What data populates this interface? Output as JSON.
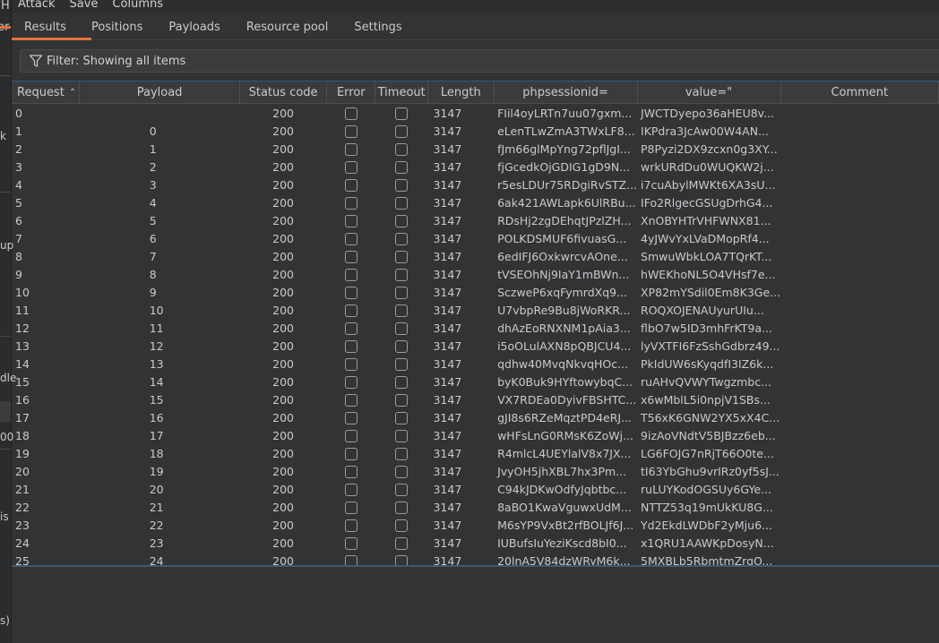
{
  "background_fragments": {
    "menu_letter": "H",
    "tab_fragment": "er",
    "texts": [
      "k",
      "up",
      "dle",
      "00",
      "is",
      "s)"
    ]
  },
  "menu": {
    "items": [
      "Attack",
      "Save",
      "Columns"
    ]
  },
  "tabs": [
    {
      "label": "Results",
      "active": true
    },
    {
      "label": "Positions",
      "active": false
    },
    {
      "label": "Payloads",
      "active": false
    },
    {
      "label": "Resource pool",
      "active": false
    },
    {
      "label": "Settings",
      "active": false
    }
  ],
  "filter": {
    "icon": "filter-funnel-icon",
    "label": "Filter: Showing all items"
  },
  "table": {
    "sort_icon": "chevron-up-icon",
    "columns": [
      "Request",
      "Payload",
      "Status code",
      "Error",
      "Timeout",
      "Length",
      "phpsessionid=",
      "value=\"",
      "Comment"
    ],
    "rows": [
      {
        "request": "0",
        "payload": "",
        "status": "200",
        "error": false,
        "timeout": false,
        "length": "3147",
        "phpsessionid": "FIil4oyLRTn7uu07gxm...",
        "value": "JWCTDyepo36aHEU8v...",
        "comment": ""
      },
      {
        "request": "1",
        "payload": "0",
        "status": "200",
        "error": false,
        "timeout": false,
        "length": "3147",
        "phpsessionid": "eLenTLwZmA3TWxLF8...",
        "value": "IKPdra3JcAw00W4AN...",
        "comment": ""
      },
      {
        "request": "2",
        "payload": "1",
        "status": "200",
        "error": false,
        "timeout": false,
        "length": "3147",
        "phpsessionid": "fJm66glMpYng72pflJgI...",
        "value": "P8Pyzi2DX9zcxn0g3XY...",
        "comment": ""
      },
      {
        "request": "3",
        "payload": "2",
        "status": "200",
        "error": false,
        "timeout": false,
        "length": "3147",
        "phpsessionid": "fjGcedkOjGDIG1gD9N...",
        "value": "wrkURdDu0WUQKW2j...",
        "comment": ""
      },
      {
        "request": "4",
        "payload": "3",
        "status": "200",
        "error": false,
        "timeout": false,
        "length": "3147",
        "phpsessionid": "r5esLDUr75RDgiRvSTZ...",
        "value": "i7cuAbylMWKt6XA3sU...",
        "comment": ""
      },
      {
        "request": "5",
        "payload": "4",
        "status": "200",
        "error": false,
        "timeout": false,
        "length": "3147",
        "phpsessionid": "6ak421AWLapk6UlRBu...",
        "value": "IFo2RlgecGSUgDrhG4...",
        "comment": ""
      },
      {
        "request": "6",
        "payload": "5",
        "status": "200",
        "error": false,
        "timeout": false,
        "length": "3147",
        "phpsessionid": "RDsHj2zgDEhqtJPzlZH...",
        "value": "XnOBYHTrVHFWNX81...",
        "comment": ""
      },
      {
        "request": "7",
        "payload": "6",
        "status": "200",
        "error": false,
        "timeout": false,
        "length": "3147",
        "phpsessionid": "POLKDSMUF6fivuasG...",
        "value": "4yJWvYxLVaDMopRf4...",
        "comment": ""
      },
      {
        "request": "8",
        "payload": "7",
        "status": "200",
        "error": false,
        "timeout": false,
        "length": "3147",
        "phpsessionid": "6edIFJ6OxkwrcvAOne...",
        "value": "SmwuWbkLOA7TQrKT...",
        "comment": ""
      },
      {
        "request": "9",
        "payload": "8",
        "status": "200",
        "error": false,
        "timeout": false,
        "length": "3147",
        "phpsessionid": "tVSEOhNj9IaY1mBWn...",
        "value": "hWEKhoNL5O4VHsf7e...",
        "comment": ""
      },
      {
        "request": "10",
        "payload": "9",
        "status": "200",
        "error": false,
        "timeout": false,
        "length": "3147",
        "phpsessionid": "SczweP6xqFymrdXq9...",
        "value": "XP82mYSdil0Em8K3Ge...",
        "comment": ""
      },
      {
        "request": "11",
        "payload": "10",
        "status": "200",
        "error": false,
        "timeout": false,
        "length": "3147",
        "phpsessionid": "U7vbpRe9Bu8jWoRKR...",
        "value": "ROQXOJENAUyurUIu...",
        "comment": ""
      },
      {
        "request": "12",
        "payload": "11",
        "status": "200",
        "error": false,
        "timeout": false,
        "length": "3147",
        "phpsessionid": "dhAzEoRNXNM1pAia3...",
        "value": "flbO7w5ID3mhFrKT9a...",
        "comment": ""
      },
      {
        "request": "13",
        "payload": "12",
        "status": "200",
        "error": false,
        "timeout": false,
        "length": "3147",
        "phpsessionid": "i5oOLulAXN8pQBJCU4...",
        "value": "lyVXTFI6FzSshGdbrz49...",
        "comment": ""
      },
      {
        "request": "14",
        "payload": "13",
        "status": "200",
        "error": false,
        "timeout": false,
        "length": "3147",
        "phpsessionid": "qdhw40MvqNkvqHOc...",
        "value": "PkIdUW6sKyqdfI3IZ6k...",
        "comment": ""
      },
      {
        "request": "15",
        "payload": "14",
        "status": "200",
        "error": false,
        "timeout": false,
        "length": "3147",
        "phpsessionid": "byK0Buk9HYftowybqC...",
        "value": "ruAHvQVWYTwgzmbc...",
        "comment": ""
      },
      {
        "request": "16",
        "payload": "15",
        "status": "200",
        "error": false,
        "timeout": false,
        "length": "3147",
        "phpsessionid": "VX7RDEa0DyivFBSHTC...",
        "value": "x6wMblL5i0npjV1SBs...",
        "comment": ""
      },
      {
        "request": "17",
        "payload": "16",
        "status": "200",
        "error": false,
        "timeout": false,
        "length": "3147",
        "phpsessionid": "gJI8s6RZeMqztPD4eRJ...",
        "value": "T56xK6GNW2YX5xX4C...",
        "comment": ""
      },
      {
        "request": "18",
        "payload": "17",
        "status": "200",
        "error": false,
        "timeout": false,
        "length": "3147",
        "phpsessionid": "wHFsLnG0RMsK6ZoWj...",
        "value": "9izAoVNdtV5BJBzz6eb...",
        "comment": ""
      },
      {
        "request": "19",
        "payload": "18",
        "status": "200",
        "error": false,
        "timeout": false,
        "length": "3147",
        "phpsessionid": "R4mlcL4UEYlalV8x7JX...",
        "value": "LG6FOJG7nRjT66O0te...",
        "comment": ""
      },
      {
        "request": "20",
        "payload": "19",
        "status": "200",
        "error": false,
        "timeout": false,
        "length": "3147",
        "phpsessionid": "JvyOH5jhXBL7hx3Pm...",
        "value": "tI63YbGhu9vrIRz0yf5sJ...",
        "comment": ""
      },
      {
        "request": "21",
        "payload": "20",
        "status": "200",
        "error": false,
        "timeout": false,
        "length": "3147",
        "phpsessionid": "C94kJDKwOdfyJqbtbc...",
        "value": "ruLUYKodOGSUy6GYe...",
        "comment": ""
      },
      {
        "request": "22",
        "payload": "21",
        "status": "200",
        "error": false,
        "timeout": false,
        "length": "3147",
        "phpsessionid": "8aBO1KwaVguwxUdM...",
        "value": "NTTZ53q19mUkKU8G...",
        "comment": ""
      },
      {
        "request": "23",
        "payload": "22",
        "status": "200",
        "error": false,
        "timeout": false,
        "length": "3147",
        "phpsessionid": "M6sYP9VxBt2rfBOLJf6J...",
        "value": "Yd2EkdLWDbF2yMju6...",
        "comment": ""
      },
      {
        "request": "24",
        "payload": "23",
        "status": "200",
        "error": false,
        "timeout": false,
        "length": "3147",
        "phpsessionid": "IUBufsIuYeziKscd8bI0...",
        "value": "x1QRU1AAWKpDosyN...",
        "comment": ""
      },
      {
        "request": "25",
        "payload": "24",
        "status": "200",
        "error": false,
        "timeout": false,
        "length": "3147",
        "phpsessionid": "20lnA5V84dzWRyM6k...",
        "value": "5MXBLb5RbmtmZrgO...",
        "comment": ""
      }
    ]
  },
  "colors": {
    "accent": "#e2723a",
    "background": "#323335",
    "table_border": "#2e5a86"
  }
}
